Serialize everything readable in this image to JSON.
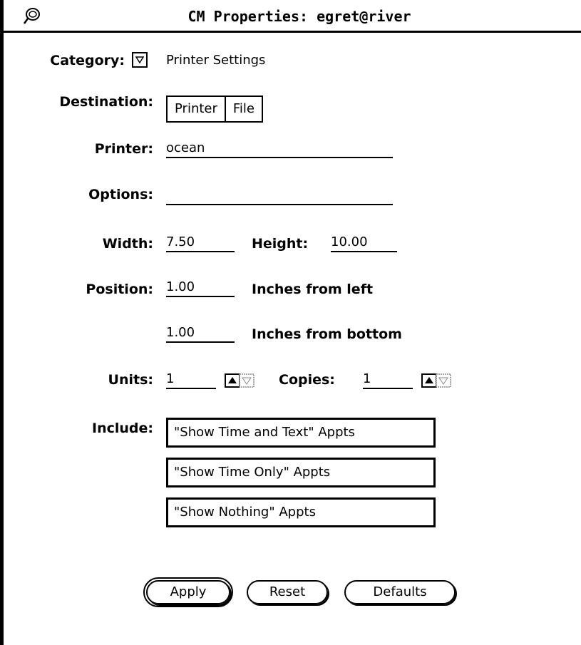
{
  "window": {
    "title": "CM Properties: egret@river"
  },
  "category": {
    "label": "Category:",
    "value": "Printer Settings"
  },
  "destination": {
    "label": "Destination:",
    "options": [
      "Printer",
      "File"
    ],
    "selected": "Printer"
  },
  "printer": {
    "label": "Printer:",
    "value": "ocean"
  },
  "options": {
    "label": "Options:",
    "value": ""
  },
  "size": {
    "width_label": "Width:",
    "width_value": "7.50",
    "height_label": "Height:",
    "height_value": "10.00"
  },
  "position": {
    "label": "Position:",
    "left_value": "1.00",
    "left_suffix": "Inches from left",
    "bottom_value": "1.00",
    "bottom_suffix": "Inches from bottom"
  },
  "units": {
    "label": "Units:",
    "value": "1"
  },
  "copies": {
    "label": "Copies:",
    "value": "1"
  },
  "include": {
    "label": "Include:",
    "items": [
      "\"Show Time and Text\" Appts",
      "\"Show Time Only\" Appts",
      "\"Show Nothing\" Appts"
    ]
  },
  "buttons": {
    "apply": "Apply",
    "reset": "Reset",
    "defaults": "Defaults"
  }
}
